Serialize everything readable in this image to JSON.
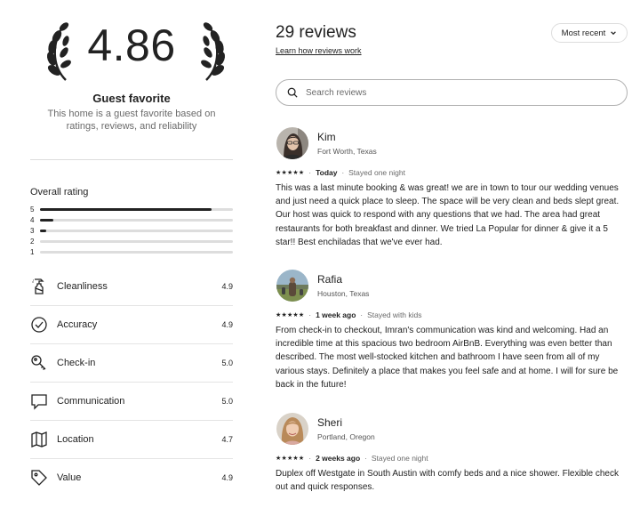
{
  "summary": {
    "rating": "4.86",
    "badge_title": "Guest favorite",
    "badge_description": "This home is a guest favorite based on ratings, reviews, and reliability"
  },
  "overall": {
    "title": "Overall rating",
    "distribution": [
      {
        "label": "5",
        "fraction": 0.89
      },
      {
        "label": "4",
        "fraction": 0.07
      },
      {
        "label": "3",
        "fraction": 0.03
      },
      {
        "label": "2",
        "fraction": 0.0
      },
      {
        "label": "1",
        "fraction": 0.0
      }
    ]
  },
  "categories": [
    {
      "label": "Cleanliness",
      "value": "4.9",
      "icon": "spray-bottle-icon"
    },
    {
      "label": "Accuracy",
      "value": "4.9",
      "icon": "check-circle-icon"
    },
    {
      "label": "Check-in",
      "value": "5.0",
      "icon": "key-icon"
    },
    {
      "label": "Communication",
      "value": "5.0",
      "icon": "message-bubble-icon"
    },
    {
      "label": "Location",
      "value": "4.7",
      "icon": "map-icon"
    },
    {
      "label": "Value",
      "value": "4.9",
      "icon": "tag-icon"
    }
  ],
  "header": {
    "count_label": "29 reviews",
    "learn_link": "Learn how reviews work",
    "sort_label": "Most recent"
  },
  "search": {
    "placeholder": "Search reviews",
    "value": ""
  },
  "reviews": [
    {
      "name": "Kim",
      "location": "Fort Worth, Texas",
      "stars": "★★★★★",
      "when": "Today",
      "stay": "Stayed one night",
      "text": "This was a last minute booking & was great! we are in town to tour our wedding venues and just need a quick place to sleep. The space will be very clean and beds slept great. Our host was quick to respond with any questions that we had. The area had great restaurants for both breakfast and dinner. We tried La Popular for dinner & give it a 5 star!! Best enchiladas that we've ever had."
    },
    {
      "name": "Rafia",
      "location": "Houston, Texas",
      "stars": "★★★★★",
      "when": "1 week ago",
      "stay": "Stayed with kids",
      "text": "From check-in to checkout, Imran's communication was kind and welcoming. Had an incredible time at this spacious two bedroom AirBnB. Everything was even better than described. The most well-stocked kitchen and bathroom I have seen from all of my various stays. Definitely a place that makes you feel safe and at home. I will for sure be back in the future!"
    },
    {
      "name": "Sheri",
      "location": "Portland, Oregon",
      "stars": "★★★★★",
      "when": "2 weeks ago",
      "stay": "Stayed one night",
      "text": "Duplex off Westgate in South Austin with comfy beds and a nice shower. Flexible check out and quick responses."
    }
  ]
}
